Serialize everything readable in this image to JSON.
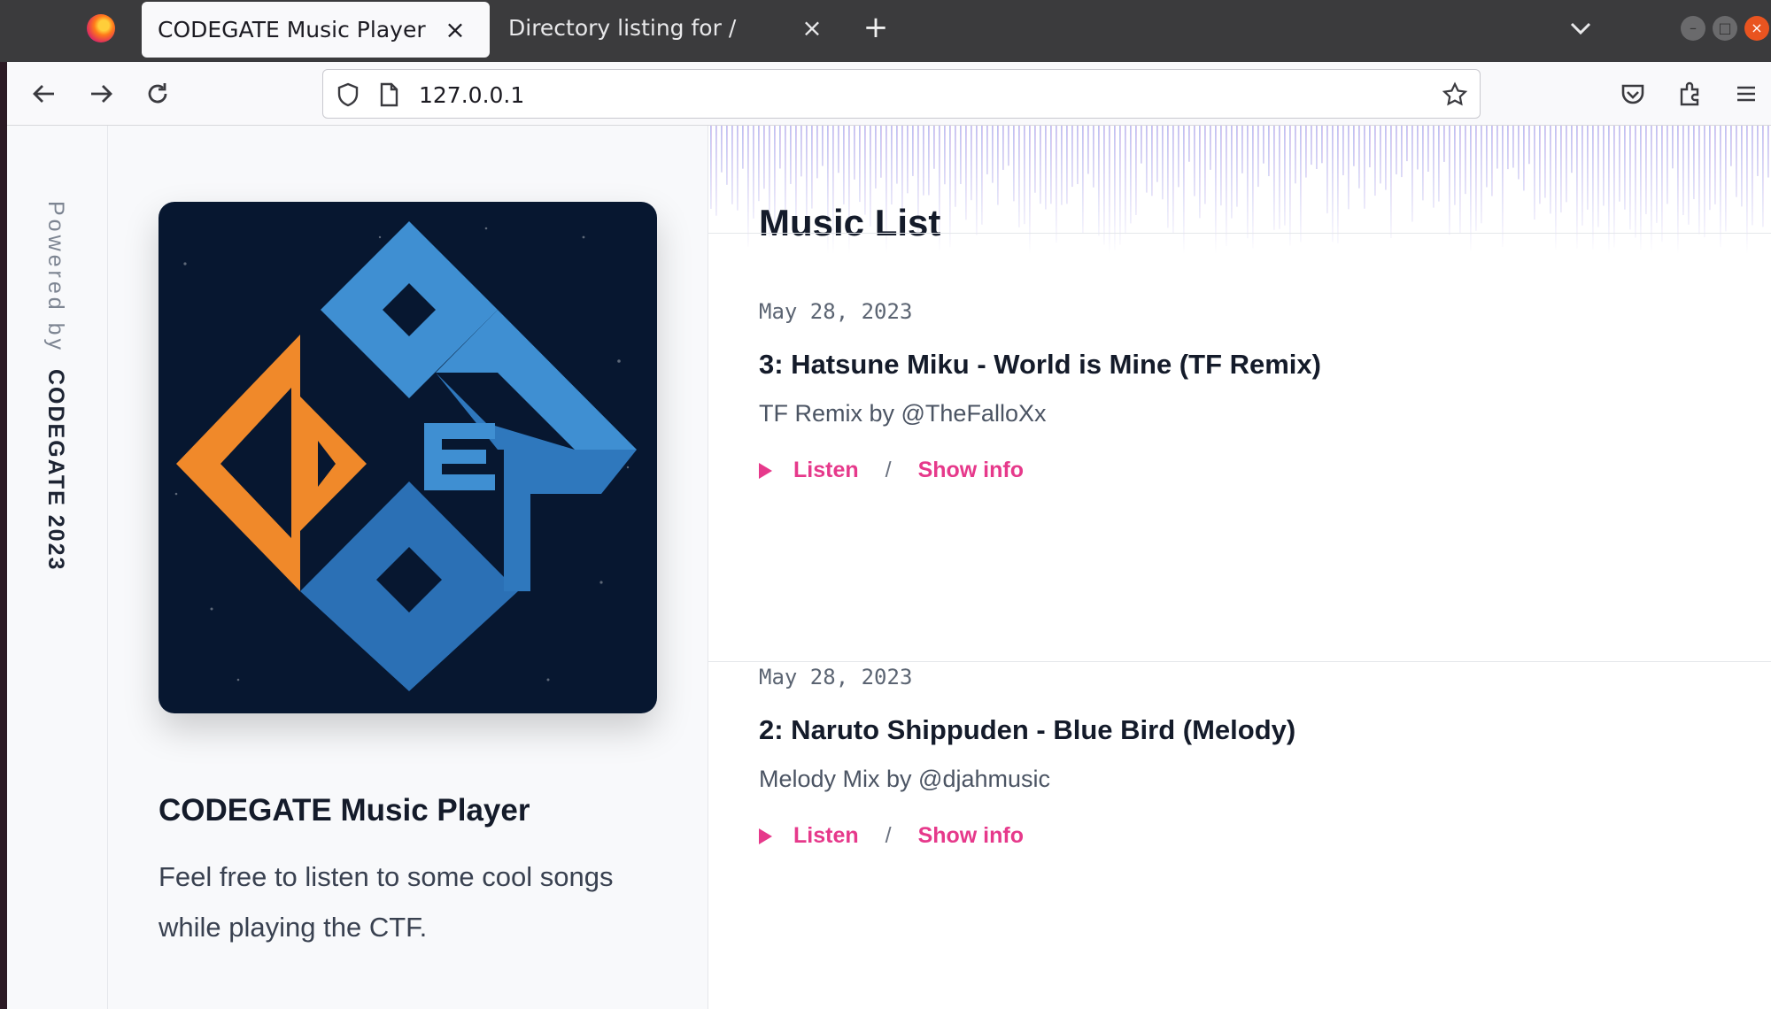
{
  "browser": {
    "tabs": [
      {
        "title": "CODEGATE Music Player",
        "active": true
      },
      {
        "title": "Directory listing for /",
        "active": false
      }
    ],
    "url": "127.0.0.1",
    "icons": [
      "firefox-icon",
      "back-icon",
      "forward-icon",
      "reload-icon",
      "shield-icon",
      "page-icon",
      "bookmark-star-icon",
      "pocket-icon",
      "extensions-icon",
      "menu-icon",
      "new-tab-icon",
      "tab-overflow-icon"
    ]
  },
  "sidebar": {
    "powered_by": "Powered by",
    "brand": "CODEGATE 2023"
  },
  "player": {
    "title": "CODEGATE Music Player",
    "description": "Feel free to listen to some cool songs while playing the CTF."
  },
  "music_list": {
    "title": "Music List",
    "listen_label": "Listen",
    "separator": "/",
    "info_label": "Show info",
    "tracks": [
      {
        "date": "May 28, 2023",
        "title": "3: Hatsune Miku - World is Mine (TF Remix)",
        "subtitle": "TF Remix by @TheFalloXx"
      },
      {
        "date": "May 28, 2023",
        "title": "2: Naruto Shippuden - Blue Bird (Melody)",
        "subtitle": "Melody Mix by @djahmusic"
      }
    ]
  },
  "colors": {
    "accent": "#e6398b",
    "cover_bg": "#071730",
    "logo_orange": "#f0892a",
    "logo_blue": "#3f8fd2"
  }
}
